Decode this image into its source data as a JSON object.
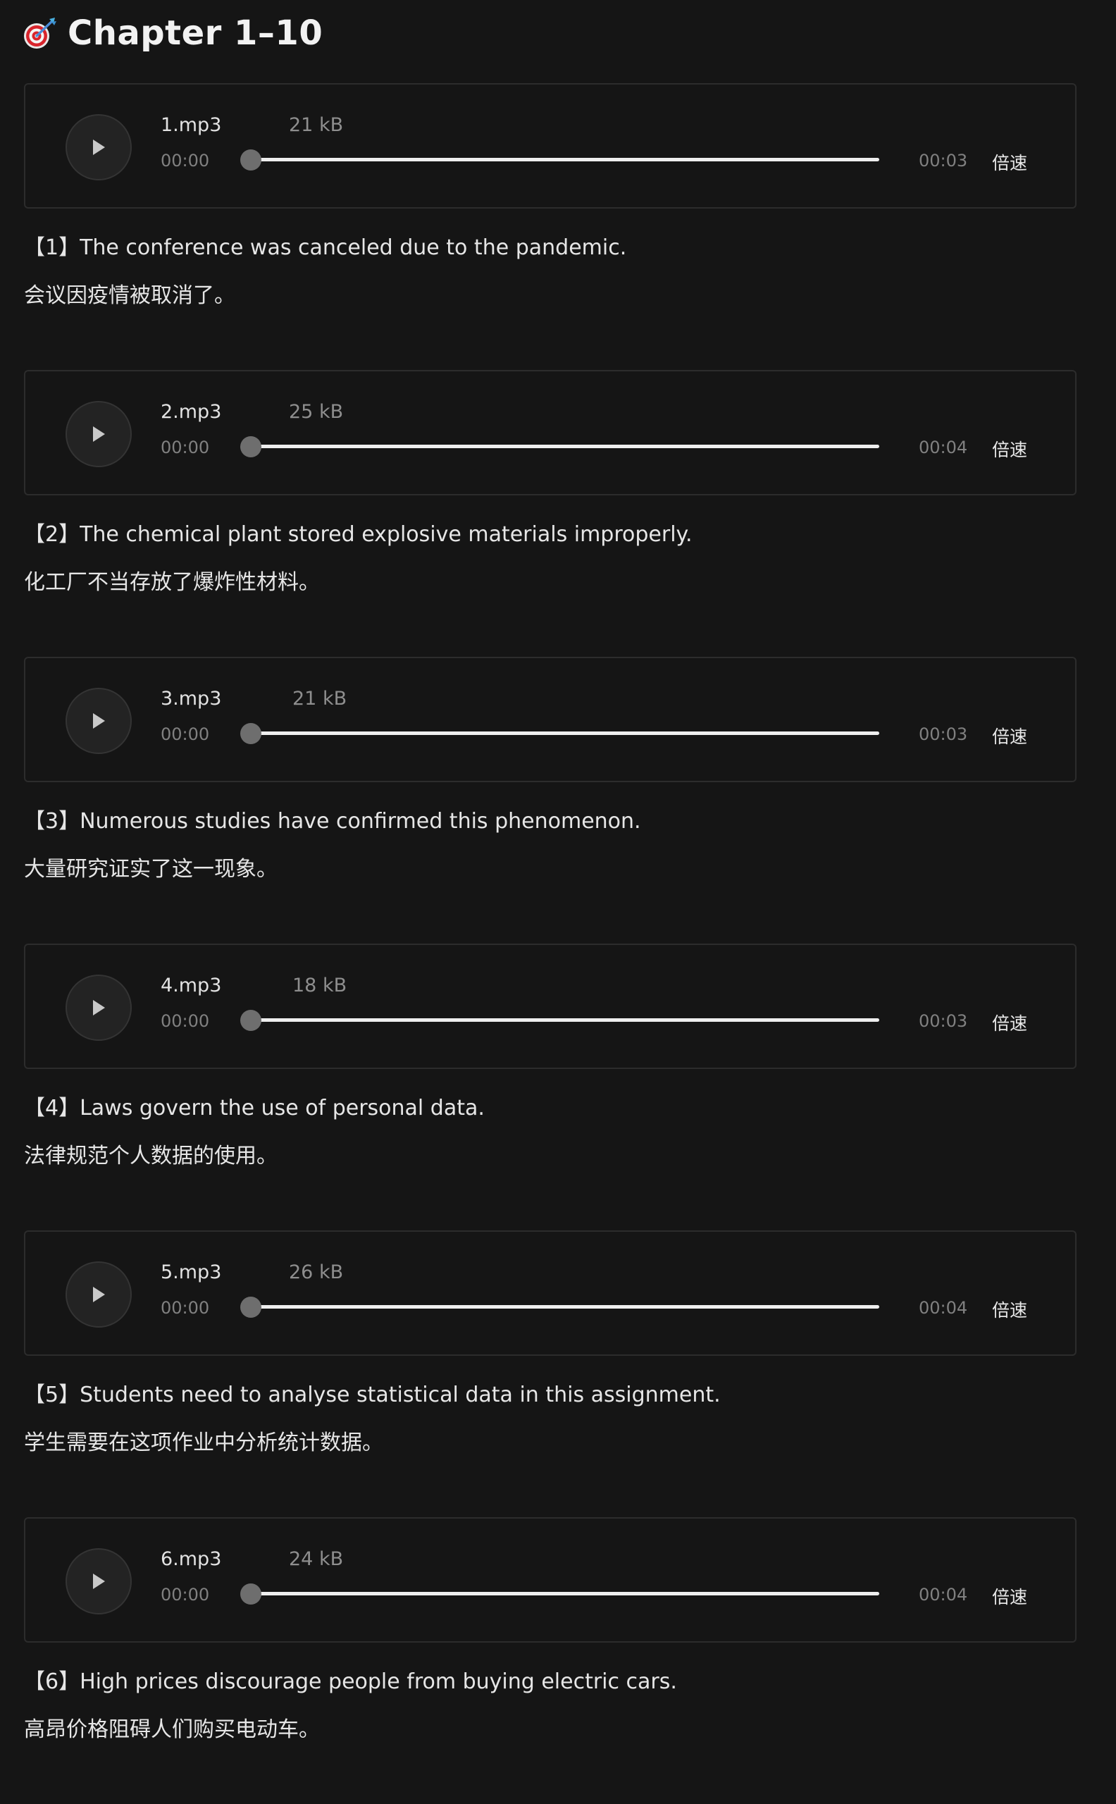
{
  "header": {
    "icon": "dart-target-icon",
    "title": "Chapter 1–10"
  },
  "colors": {
    "background": "#151515",
    "card_border": "#2c2c2c",
    "play_button": "#232323",
    "track": "#eeeeee",
    "knob": "#6e6e6e"
  },
  "speed_label": "倍速",
  "items": [
    {
      "file": "1.mp3",
      "size": "21 kB",
      "current": "00:00",
      "duration": "00:03",
      "progress": 0,
      "en": "【1】The conference was canceled due to the pandemic.",
      "zh": "会议因疫情被取消了。"
    },
    {
      "file": "2.mp3",
      "size": "25 kB",
      "current": "00:00",
      "duration": "00:04",
      "progress": 0,
      "en": "【2】The chemical plant stored explosive materials improperly.",
      "zh": "化工厂不当存放了爆炸性材料。"
    },
    {
      "file": "3.mp3",
      "size": "21 kB",
      "current": "00:00",
      "duration": "00:03",
      "progress": 0,
      "en": "【3】Numerous studies have confirmed this phenomenon.",
      "zh": "大量研究证实了这一现象。"
    },
    {
      "file": "4.mp3",
      "size": "18 kB",
      "current": "00:00",
      "duration": "00:03",
      "progress": 0,
      "en": "【4】Laws govern the use of personal data.",
      "zh": "法律规范个人数据的使用。"
    },
    {
      "file": "5.mp3",
      "size": "26 kB",
      "current": "00:00",
      "duration": "00:04",
      "progress": 0,
      "en": "【5】Students need to analyse statistical data in this assignment.",
      "zh": "学生需要在这项作业中分析统计数据。"
    },
    {
      "file": "6.mp3",
      "size": "24 kB",
      "current": "00:00",
      "duration": "00:04",
      "progress": 0,
      "en": "【6】High prices discourage people from buying electric cars.",
      "zh": "高昂价格阻碍人们购买电动车。"
    }
  ]
}
